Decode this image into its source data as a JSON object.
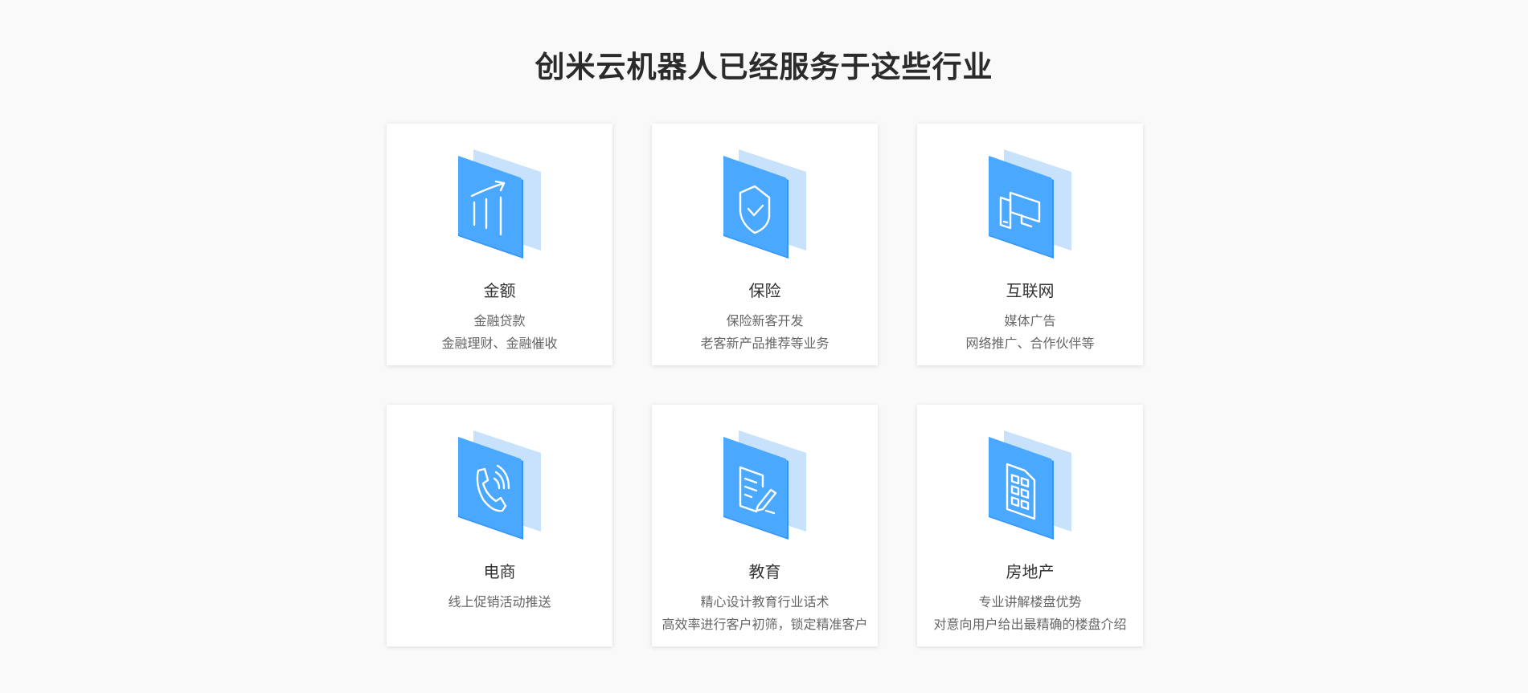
{
  "section": {
    "title": "创米云机器人已经服务于这些行业"
  },
  "colors": {
    "icon_front": "#4aa8ff",
    "icon_back": "#c8e2fb",
    "icon_line": "#ffffff"
  },
  "cards": [
    {
      "icon": "finance-chart-icon",
      "title": "金额",
      "lines": [
        "金融贷款",
        "金融理财、金融催收"
      ]
    },
    {
      "icon": "shield-check-icon",
      "title": "保险",
      "lines": [
        "保险新客开发",
        "老客新产品推荐等业务"
      ]
    },
    {
      "icon": "devices-icon",
      "title": "互联网",
      "lines": [
        "媒体广告",
        "网络推广、合作伙伴等"
      ]
    },
    {
      "icon": "phone-call-icon",
      "title": "电商",
      "lines": [
        "线上促销活动推送"
      ]
    },
    {
      "icon": "document-edit-icon",
      "title": "教育",
      "lines": [
        "精心设计教育行业话术",
        "高效率进行客户初筛，锁定精准客户"
      ]
    },
    {
      "icon": "building-icon",
      "title": "房地产",
      "lines": [
        "专业讲解楼盘优势",
        "对意向用户给出最精确的楼盘介绍"
      ]
    }
  ]
}
